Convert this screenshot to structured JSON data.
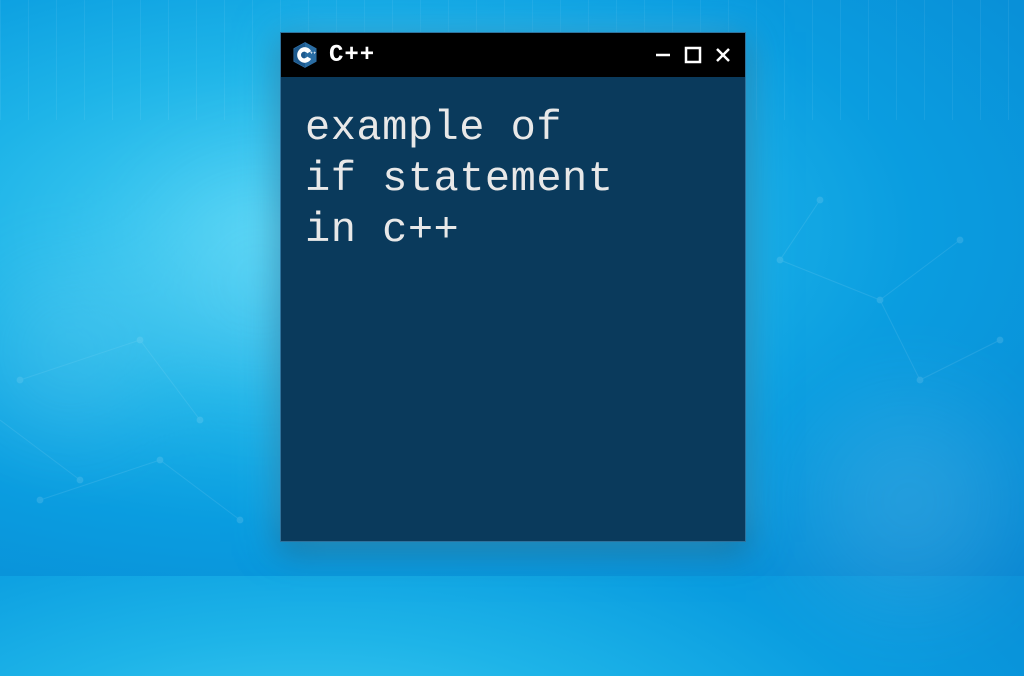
{
  "window": {
    "title": "C++",
    "body_text": "example of\nif statement\nin c++"
  },
  "icons": {
    "cpp": "C++",
    "minimize": "−",
    "maximize": "□",
    "close": "×"
  },
  "colors": {
    "titlebar": "#000000",
    "body_bg": "#0a3a5c",
    "text": "#e8e8e8",
    "cpp_icon": "#1e5a8e"
  }
}
